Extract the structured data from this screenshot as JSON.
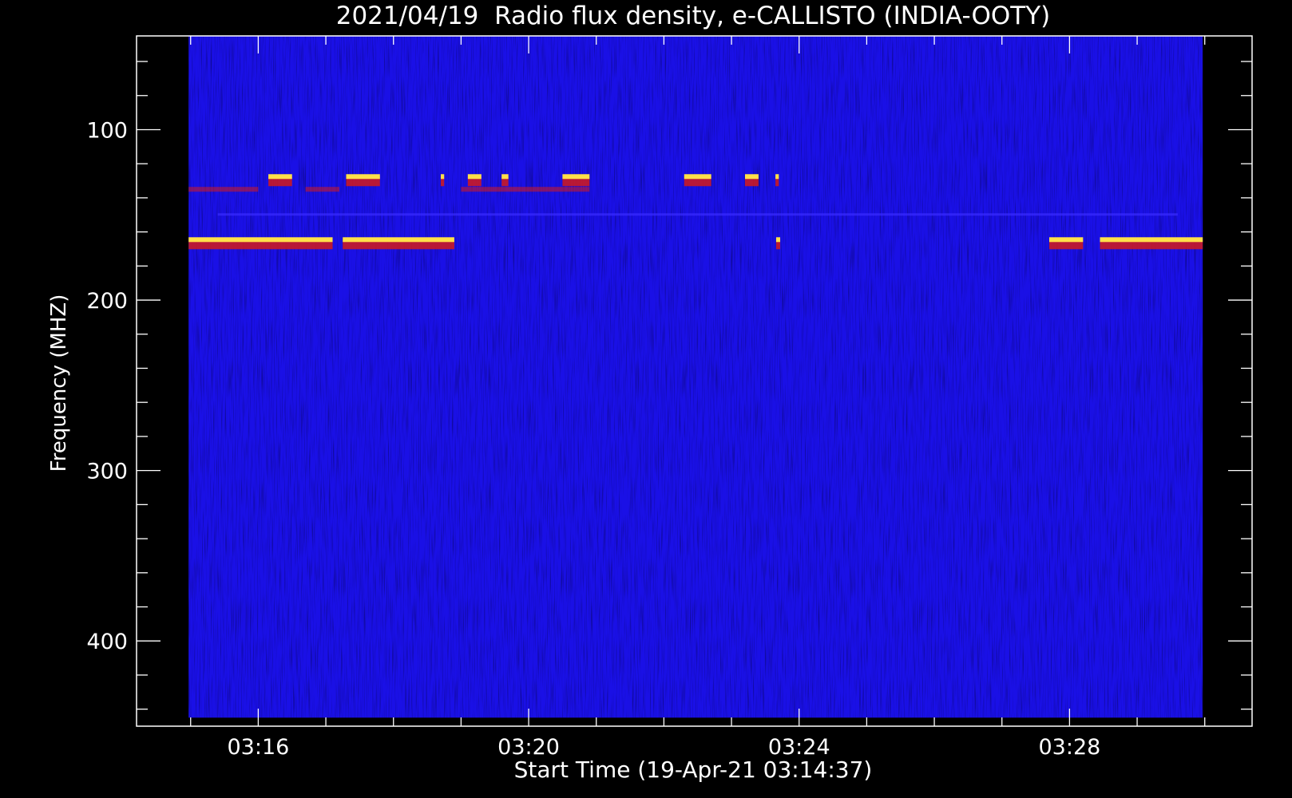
{
  "chart_data": {
    "type": "heatmap",
    "title": "2021/04/19  Radio flux density, e-CALLISTO (INDIA-OOTY)",
    "xlabel": "Start Time (19-Apr-21 03:14:37)",
    "ylabel": "Frequency (MHZ)",
    "x_tick_labels": [
      "03:16",
      "03:20",
      "03:24",
      "03:28"
    ],
    "x_ticks_minutes": [
      16,
      20,
      24,
      28
    ],
    "x_range_minutes": [
      14.2,
      30.7
    ],
    "x_data_range_minutes": [
      14.97,
      29.97
    ],
    "y_tick_labels": [
      "100",
      "200",
      "300",
      "400"
    ],
    "y_ticks": [
      100,
      200,
      300,
      400
    ],
    "y_range": [
      45,
      450
    ],
    "y_data_range": [
      45,
      445
    ],
    "y_inverted": true,
    "background_color": "#1a10e6",
    "colors": {
      "background": "#000000",
      "low": "#1a10e6",
      "mid": "#d51a1a",
      "high": "#ffe04a",
      "axes": "#ffffff"
    },
    "emission_bands": [
      {
        "freq_mhz": 128,
        "intensity": "high",
        "segments_minutes": [
          [
            16.15,
            16.5
          ],
          [
            17.3,
            17.8
          ],
          [
            18.7,
            18.75
          ],
          [
            19.1,
            19.3
          ],
          [
            19.6,
            19.7
          ],
          [
            20.5,
            20.9
          ],
          [
            22.3,
            22.7
          ],
          [
            23.2,
            23.4
          ],
          [
            23.65,
            23.7
          ]
        ]
      },
      {
        "freq_mhz": 135,
        "intensity": "mid",
        "segments_minutes": [
          [
            14.97,
            16.0
          ],
          [
            16.7,
            17.2
          ],
          [
            19.0,
            20.9
          ]
        ]
      },
      {
        "freq_mhz": 150,
        "intensity": "low",
        "segments_minutes": [
          [
            15.4,
            29.6
          ]
        ]
      },
      {
        "freq_mhz": 165,
        "intensity": "high",
        "segments_minutes": [
          [
            14.97,
            17.1
          ],
          [
            17.25,
            18.9
          ],
          [
            23.66,
            23.72
          ],
          [
            27.7,
            28.2
          ],
          [
            28.45,
            29.97
          ]
        ]
      }
    ]
  }
}
